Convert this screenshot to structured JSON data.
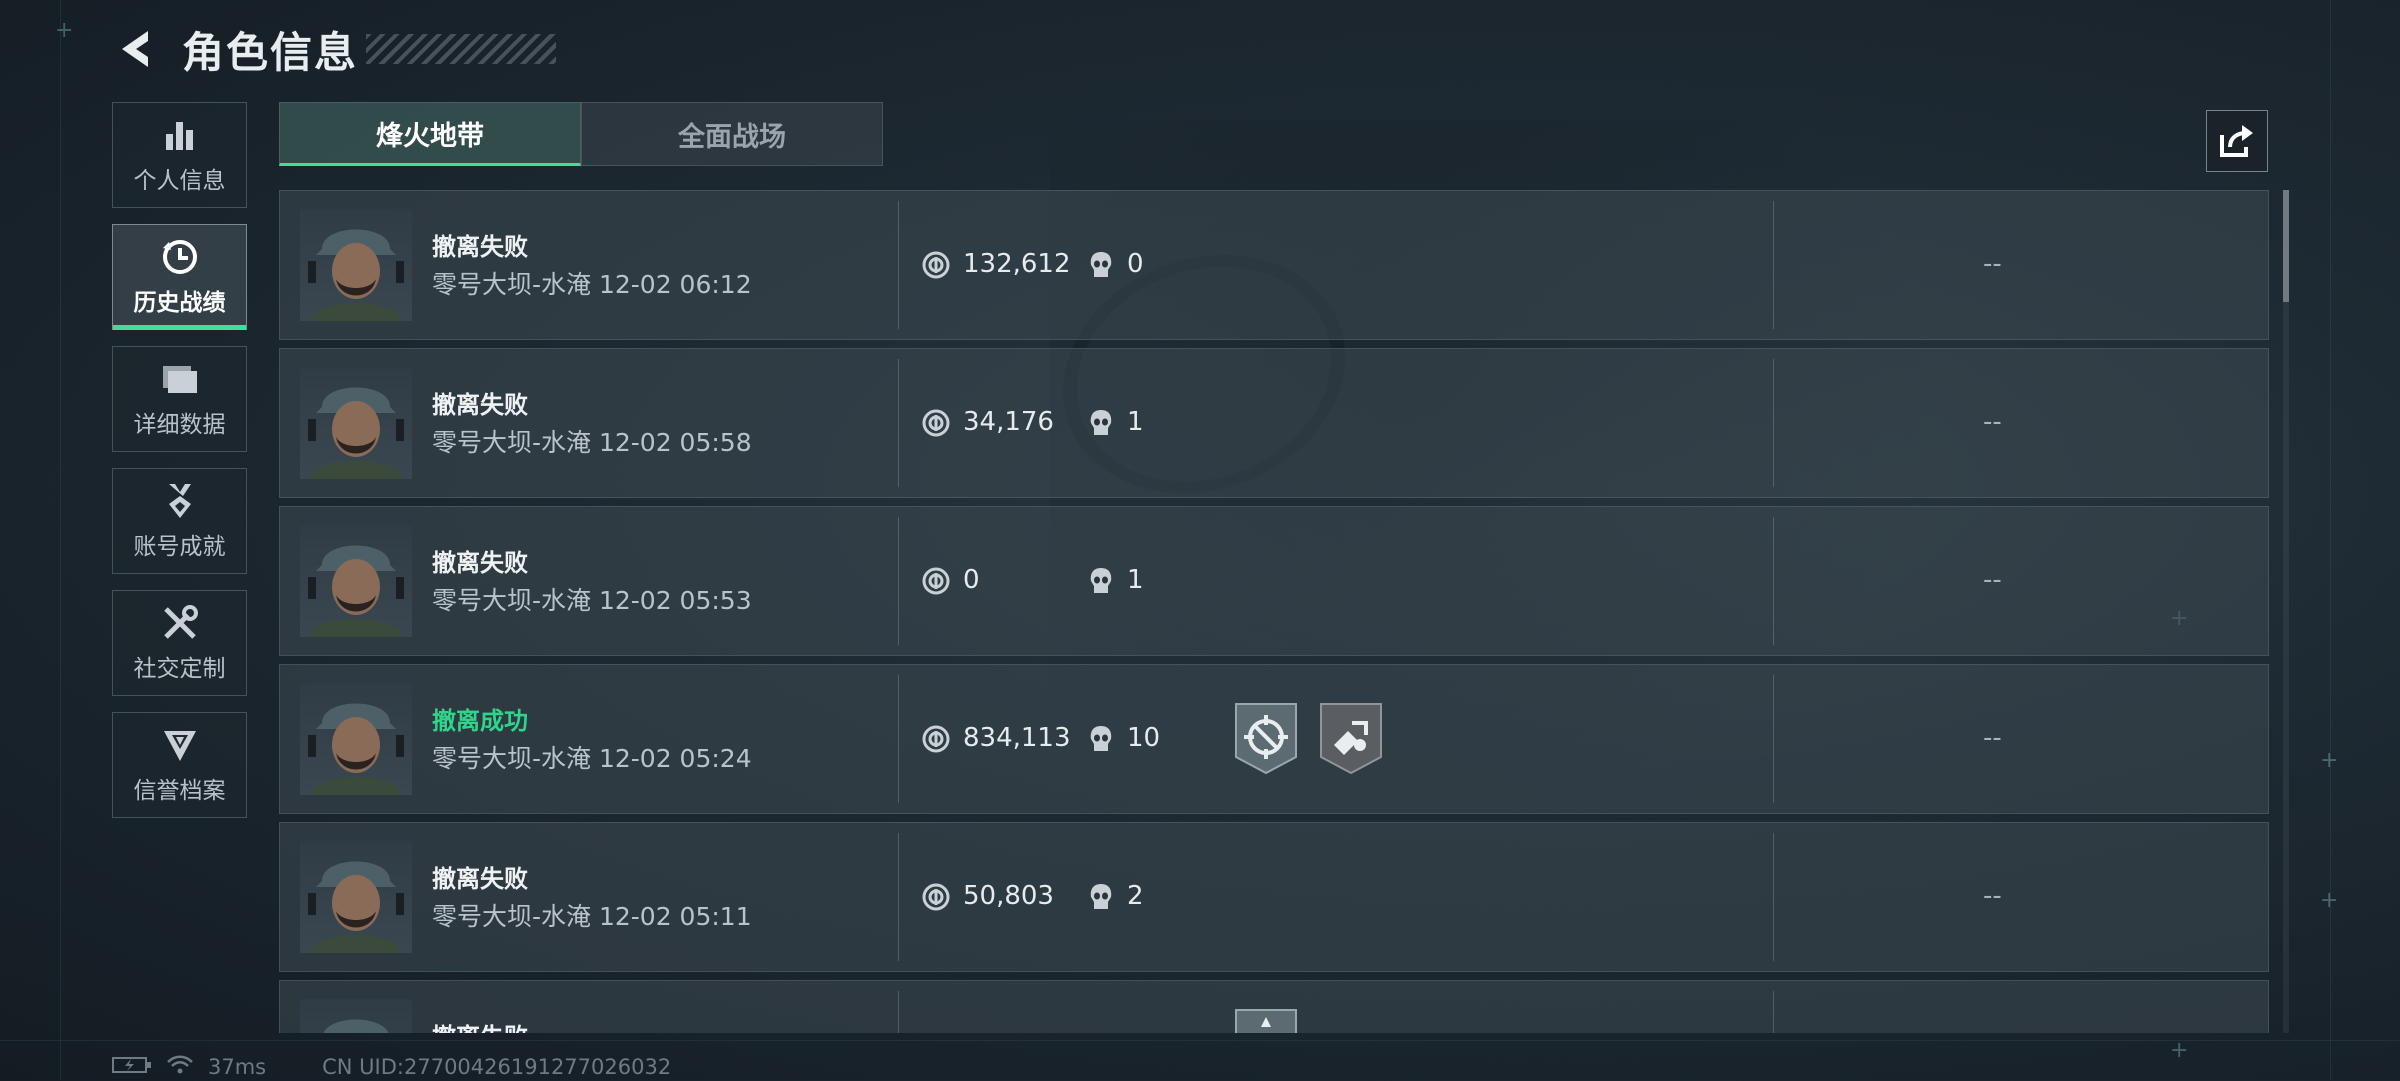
{
  "header": {
    "title": "角色信息"
  },
  "sidebar": {
    "items": [
      {
        "label": "个人信息",
        "icon": "bar-chart-icon"
      },
      {
        "label": "历史战绩",
        "icon": "clock-history-icon",
        "active": true
      },
      {
        "label": "详细数据",
        "icon": "folder-icon"
      },
      {
        "label": "账号成就",
        "icon": "medal-icon"
      },
      {
        "label": "社交定制",
        "icon": "tools-icon"
      },
      {
        "label": "信誉档案",
        "icon": "shield-emblem-icon"
      }
    ]
  },
  "tabs": [
    {
      "label": "烽火地带",
      "active": true
    },
    {
      "label": "全面战场"
    }
  ],
  "records": [
    {
      "result": "撤离失败",
      "success": false,
      "meta": "零号大坝-水淹 12-02 06:12",
      "coins": "132,612",
      "kills": "0",
      "badges": [],
      "extra": "--"
    },
    {
      "result": "撤离失败",
      "success": false,
      "meta": "零号大坝-水淹 12-02 05:58",
      "coins": "34,176",
      "kills": "1",
      "badges": [],
      "extra": "--"
    },
    {
      "result": "撤离失败",
      "success": false,
      "meta": "零号大坝-水淹 12-02 05:53",
      "coins": "0",
      "kills": "1",
      "badges": [],
      "extra": "--"
    },
    {
      "result": "撤离成功",
      "success": true,
      "meta": "零号大坝-水淹 12-02 05:24",
      "coins": "834,113",
      "kills": "10",
      "badges": [
        "crosshair-badge-icon",
        "demolition-badge-icon"
      ],
      "extra": "--"
    },
    {
      "result": "撤离失败",
      "success": false,
      "meta": "零号大坝-水淹 12-02 05:11",
      "coins": "50,803",
      "kills": "2",
      "badges": [],
      "extra": "--"
    },
    {
      "result": "撤离失败",
      "success": false,
      "meta": "",
      "coins": "",
      "kills": "",
      "badges": [
        "partial-badge-icon"
      ],
      "extra": ""
    }
  ],
  "status": {
    "ping": "37ms",
    "uid": "CN UID:27700426191277026032"
  },
  "colors": {
    "accent": "#3ce09b",
    "success": "#2ed58a"
  }
}
